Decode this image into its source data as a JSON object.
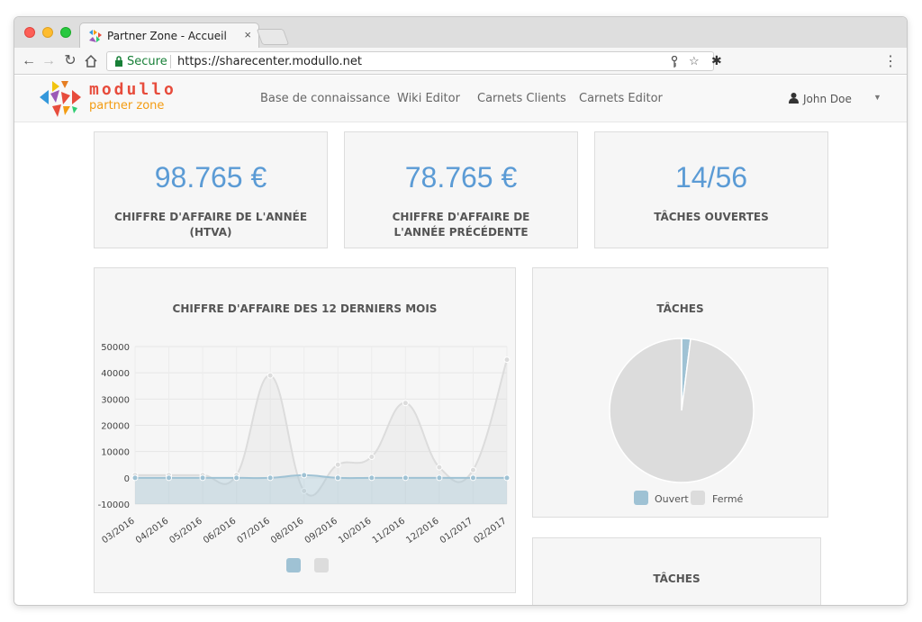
{
  "browser": {
    "tab_title": "Partner Zone - Accueil",
    "tab_close": "×",
    "secure_label": "Secure",
    "url": "https://sharecenter.modullo.net"
  },
  "header": {
    "logo_line1": "modullo",
    "logo_line2": "partner zone",
    "nav": [
      "Base de connaissance",
      "Wiki Editor",
      "Carnets Clients",
      "Carnets Editor"
    ],
    "user_name": "John Doe"
  },
  "stats": [
    {
      "value": "98.765 €",
      "label": "CHIFFRE D'AFFAIRE DE L'ANNÉE (HTVA)"
    },
    {
      "value": "78.765 €",
      "label": "CHIFFRE D'AFFAIRE DE L'ANNÉE PRÉCÉDENTE"
    },
    {
      "value": "14/56",
      "label": "TÂCHES OUVERTES"
    }
  ],
  "panels": {
    "revenue_title": "CHIFFRE D'AFFAIRE DES 12 DERNIERS MOIS",
    "tasks_title": "TÂCHES",
    "tasks_title_2": "TÂCHES"
  },
  "chart_data": [
    {
      "type": "area",
      "title": "CHIFFRE D'AFFAIRE DES 12 DERNIERS MOIS",
      "categories": [
        "03/2016",
        "04/2016",
        "05/2016",
        "06/2016",
        "07/2016",
        "08/2016",
        "09/2016",
        "10/2016",
        "11/2016",
        "12/2016",
        "01/2017",
        "02/2017"
      ],
      "series": [
        {
          "color": "#9fc2d4",
          "values": [
            0,
            0,
            0,
            0,
            0,
            1000,
            0,
            0,
            0,
            0,
            0,
            0
          ]
        },
        {
          "color": "#dcdcdc",
          "values": [
            1000,
            1000,
            1000,
            1000,
            39000,
            -5000,
            5000,
            8000,
            28500,
            4000,
            3000,
            45000
          ]
        }
      ],
      "yticks": [
        50000,
        40000,
        30000,
        20000,
        10000,
        0,
        -10000
      ],
      "ylim": [
        -10000,
        50000
      ],
      "grid": true
    },
    {
      "type": "pie",
      "title": "TÂCHES",
      "labels": [
        "Ouvert",
        "Fermé"
      ],
      "values": [
        2,
        98
      ],
      "colors": [
        "#9fc2d4",
        "#dcdcdc"
      ],
      "legend": "bottom"
    }
  ]
}
